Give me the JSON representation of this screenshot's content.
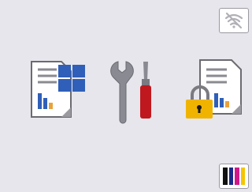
{
  "status": {
    "wifi_icon": "wifi-off-icon",
    "ink_icon": "ink-levels-icon"
  },
  "ink": {
    "colors": [
      "#111111",
      "#1a2a8a",
      "#d0188a",
      "#f5c500"
    ]
  },
  "home": {
    "tiles": [
      {
        "icon": "copy-scan-document-icon"
      },
      {
        "icon": "tools-settings-icon"
      },
      {
        "icon": "secure-print-document-icon"
      }
    ]
  }
}
